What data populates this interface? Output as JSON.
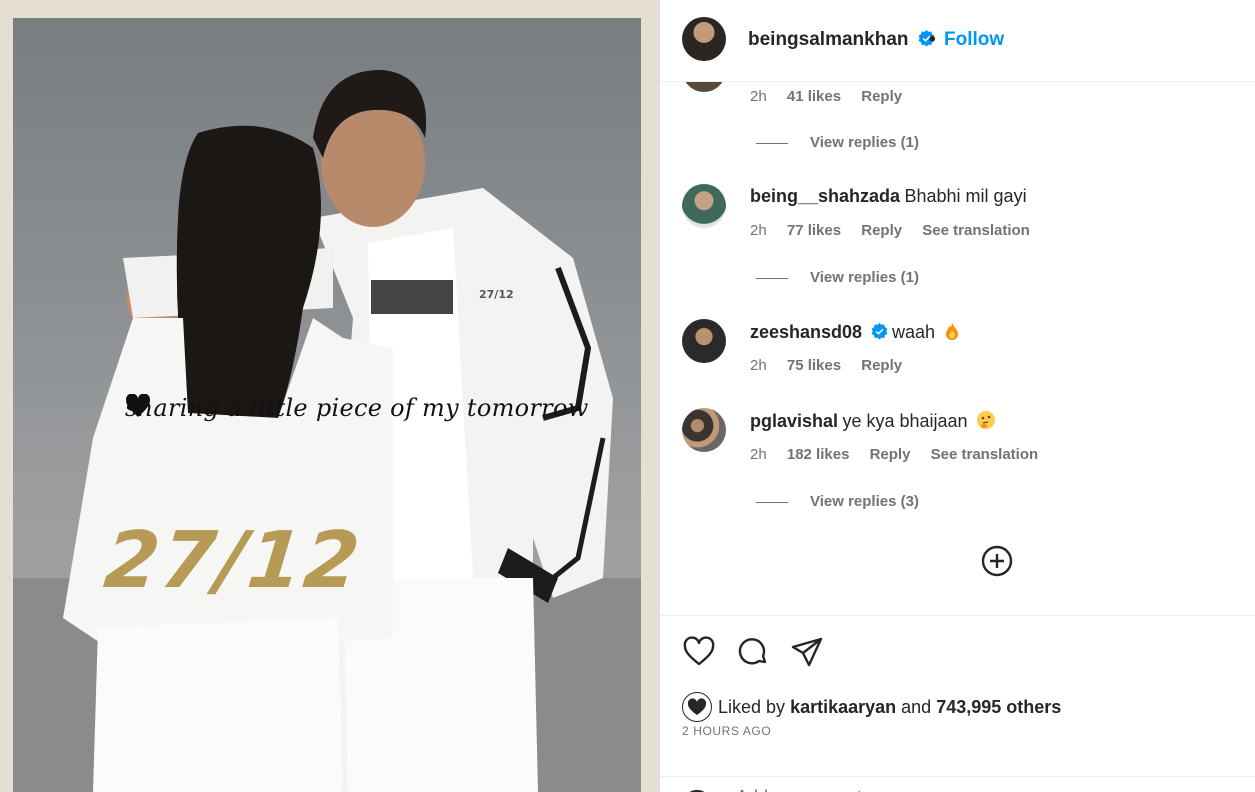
{
  "post": {
    "overlay_caption": "sharing a little piece of my",
    "overlay_caption_end": "tomorrow",
    "back_print": "27/12",
    "tee_print": "27/12"
  },
  "header": {
    "username": "beingsalmankhan",
    "dot": "•",
    "follow_label": "Follow"
  },
  "comments": [
    {
      "username": "",
      "text": "",
      "time": "2h",
      "likes": "41 likes",
      "reply": "Reply",
      "translation": "",
      "view_replies": "View replies (1)"
    },
    {
      "username": "being__shahzada",
      "text": "Bhabhi mil gayi",
      "time": "2h",
      "likes": "77 likes",
      "reply": "Reply",
      "translation": "See translation",
      "view_replies": "View replies (1)"
    },
    {
      "username": "zeeshansd08",
      "text": "waah",
      "time": "2h",
      "likes": "75 likes",
      "reply": "Reply",
      "translation": "",
      "view_replies": ""
    },
    {
      "username": "pglavishal",
      "text": "ye kya bhaijaan",
      "time": "2h",
      "likes": "182 likes",
      "reply": "Reply",
      "translation": "See translation",
      "view_replies": "View replies (3)"
    }
  ],
  "likes": {
    "prefix": "Liked by",
    "user": "kartikaaryan",
    "and": "and",
    "others": "743,995 others"
  },
  "timestamp": "2 HOURS AGO",
  "add_comment": {
    "placeholder": "Add a comment..."
  },
  "colors": {
    "accent": "#0095f6",
    "verified": "#0095f6",
    "secondary_text": "#737373",
    "brand_gold": "#b69a55"
  },
  "icons": [
    "verified-badge-icon",
    "heart-icon",
    "comment-icon",
    "share-icon",
    "plus-circle-icon",
    "smile-icon",
    "fire-emoji-icon",
    "thinking-emoji-icon",
    "black-heart-icon"
  ]
}
